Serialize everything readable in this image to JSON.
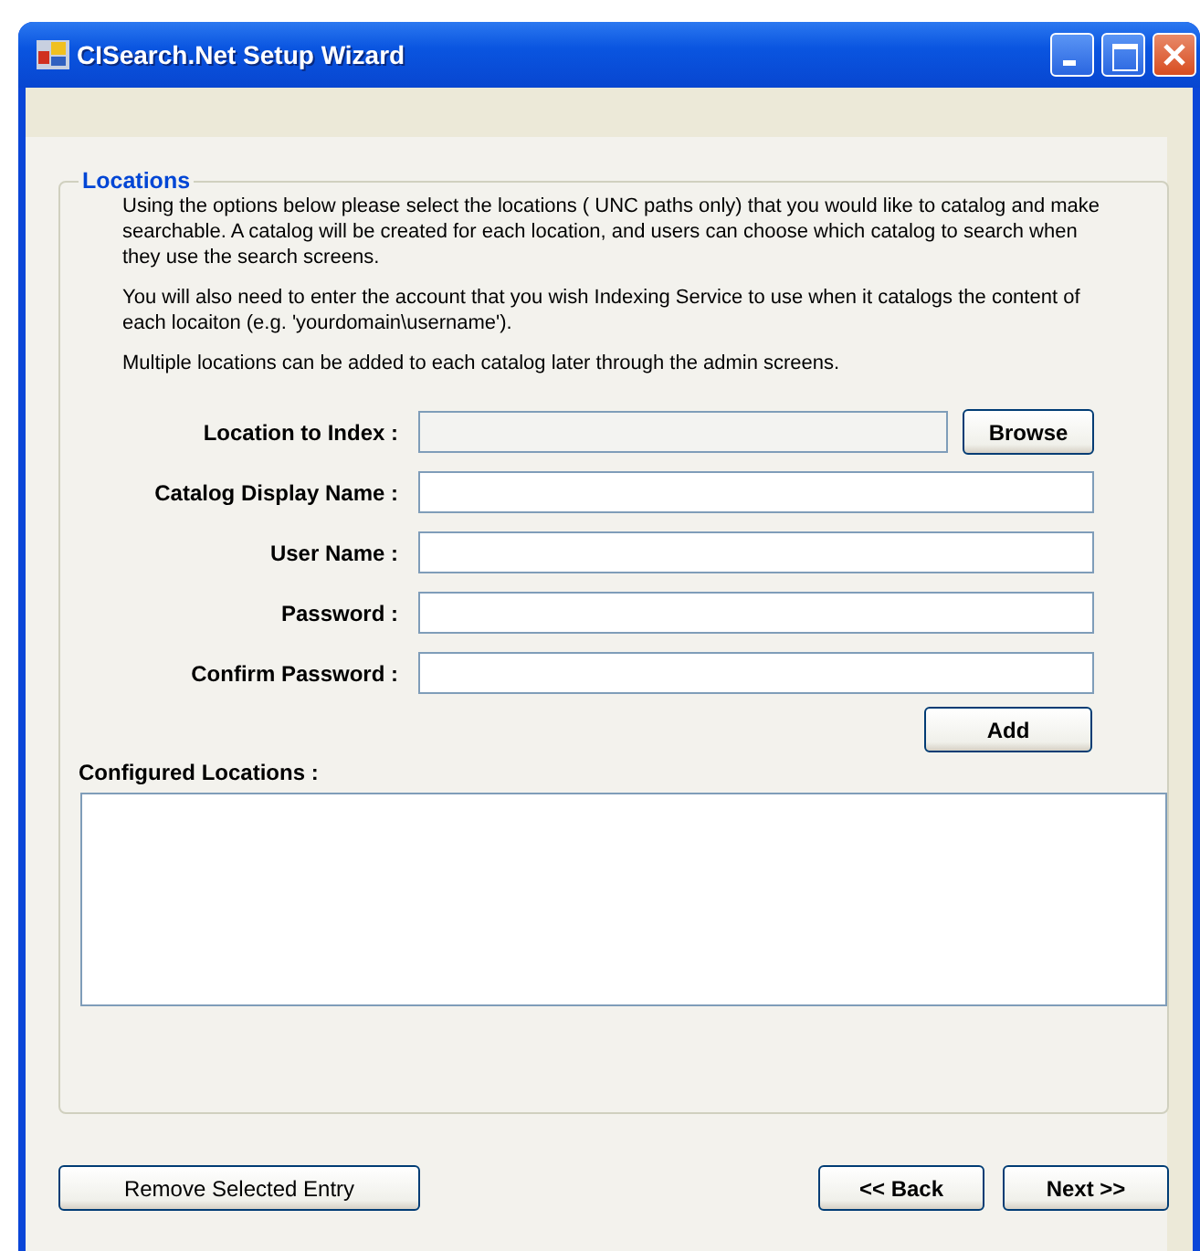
{
  "window": {
    "title": "CISearch.Net Setup Wizard"
  },
  "group": {
    "title": "Locations",
    "paragraphs": [
      "Using the options below please select the locations ( UNC paths only) that you would like to catalog and make searchable. A catalog will be created for each location, and users can choose which catalog to search when they use the search screens.",
      "You will also need to enter the account that you wish Indexing Service to use when it catalogs the content of each locaiton (e.g. 'yourdomain\\username').",
      "Multiple locations can be added to each catalog later through the admin screens."
    ],
    "fields": [
      {
        "label": "Location to Index :",
        "disabled": true,
        "button": "Browse"
      },
      {
        "label": "Catalog Display Name :",
        "disabled": false
      },
      {
        "label": "User Name :",
        "disabled": false
      },
      {
        "label": "Password :",
        "disabled": false
      },
      {
        "label": "Confirm Password :",
        "disabled": false
      }
    ],
    "add_button": "Add",
    "list_label": "Configured Locations :"
  },
  "buttons": {
    "remove": "Remove Selected Entry",
    "back": "<< Back",
    "next": "Next >>"
  }
}
